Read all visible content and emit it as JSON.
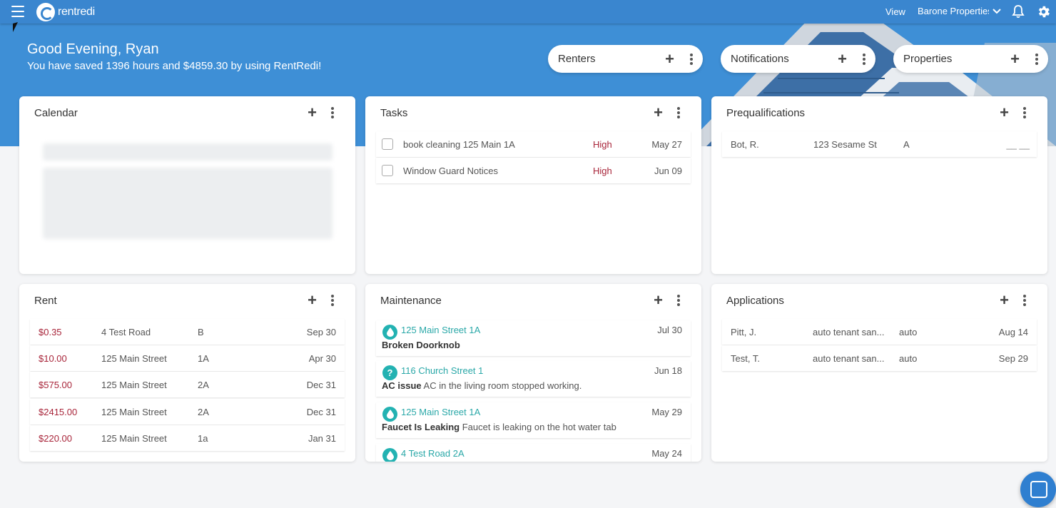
{
  "app": {
    "logo_text": "rentredi"
  },
  "header": {
    "view_label": "View",
    "view_value": "Barone Properties"
  },
  "hero": {
    "greeting": "Good Evening, Ryan",
    "savings": "You have saved 1396 hours and $4859.30 by using RentRedi!"
  },
  "pills": [
    {
      "label": "Renters"
    },
    {
      "label": "Notifications"
    },
    {
      "label": "Properties"
    }
  ],
  "icons": {
    "add": "+",
    "chevron": "⌄"
  },
  "cards": {
    "calendar": {
      "title": "Calendar"
    },
    "tasks": {
      "title": "Tasks",
      "items": [
        {
          "name": "book cleaning 125 Main 1A",
          "priority": "High",
          "date": "May 27"
        },
        {
          "name": "Window Guard Notices",
          "priority": "High",
          "date": "Jun 09"
        }
      ]
    },
    "prequalifications": {
      "title": "Prequalifications",
      "items": [
        {
          "name": "Bot, R.",
          "address": "123 Sesame St",
          "unit": "A",
          "extra": "__ __"
        }
      ]
    },
    "rent": {
      "title": "Rent",
      "items": [
        {
          "amount": "$0.35",
          "address": "4 Test Road",
          "unit": "B",
          "date": "Sep 30"
        },
        {
          "amount": "$10.00",
          "address": "125 Main Street",
          "unit": "1A",
          "date": "Apr 30"
        },
        {
          "amount": "$575.00",
          "address": "125 Main Street",
          "unit": "2A",
          "date": "Dec 31"
        },
        {
          "amount": "$2415.00",
          "address": "125 Main Street",
          "unit": "2A",
          "date": "Dec 31"
        },
        {
          "amount": "$220.00",
          "address": "125 Main Street",
          "unit": "1a",
          "date": "Jan 31"
        }
      ]
    },
    "maintenance": {
      "title": "Maintenance",
      "items": [
        {
          "icon": "water-drop-icon",
          "address": "125 Main Street 1A",
          "date": "Jul 30",
          "issue": "Broken Doorknob",
          "detail": ""
        },
        {
          "icon": "question-icon",
          "icon_glyph": "?",
          "address": "116 Church Street 1",
          "date": "Jun 18",
          "issue": "AC issue",
          "detail": "AC in the living room stopped working."
        },
        {
          "icon": "water-drop-icon",
          "address": "125 Main Street 1A",
          "date": "May 29",
          "issue": "Faucet Is Leaking",
          "detail": "Faucet is leaking on the hot water tab"
        },
        {
          "icon": "water-drop-icon",
          "address": "4 Test Road 2A",
          "date": "May 24",
          "issue": "",
          "detail": ""
        }
      ]
    },
    "applications": {
      "title": "Applications",
      "items": [
        {
          "name": "Pitt, J.",
          "source": "auto tenant san...",
          "type": "auto",
          "date": "Aug 14"
        },
        {
          "name": "Test, T.",
          "source": "auto tenant san...",
          "type": "auto",
          "date": "Sep 29"
        }
      ]
    }
  },
  "colors": {
    "brand": "#3a86cf",
    "priority_high": "#a8253a",
    "maintenance_teal": "#23b2b2"
  }
}
